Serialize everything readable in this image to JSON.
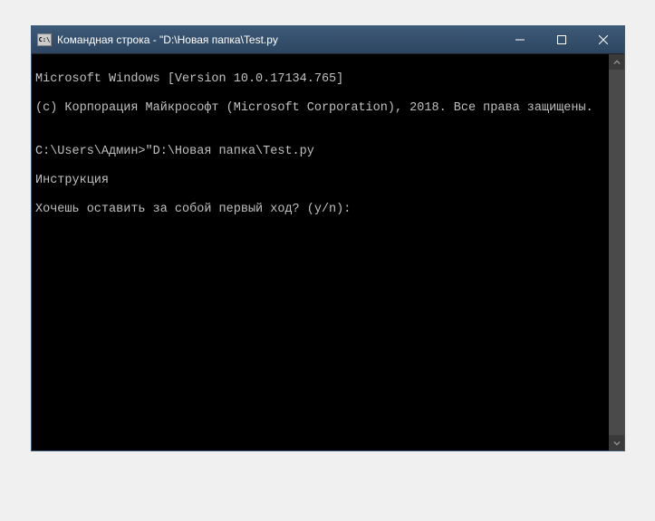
{
  "titlebar": {
    "icon_label": "C:\\",
    "title": "Командная строка - \"D:\\Новая папка\\Test.py"
  },
  "controls": {
    "minimize": "minimize",
    "maximize": "maximize",
    "close": "close"
  },
  "terminal": {
    "lines": [
      "Microsoft Windows [Version 10.0.17134.765]",
      "(c) Корпорация Майкрософт (Microsoft Corporation), 2018. Все права защищены.",
      "",
      "C:\\Users\\Админ>\"D:\\Новая папка\\Test.py",
      "Инструкция",
      "Хочешь оставить за собой первый ход? (y/n):"
    ]
  }
}
